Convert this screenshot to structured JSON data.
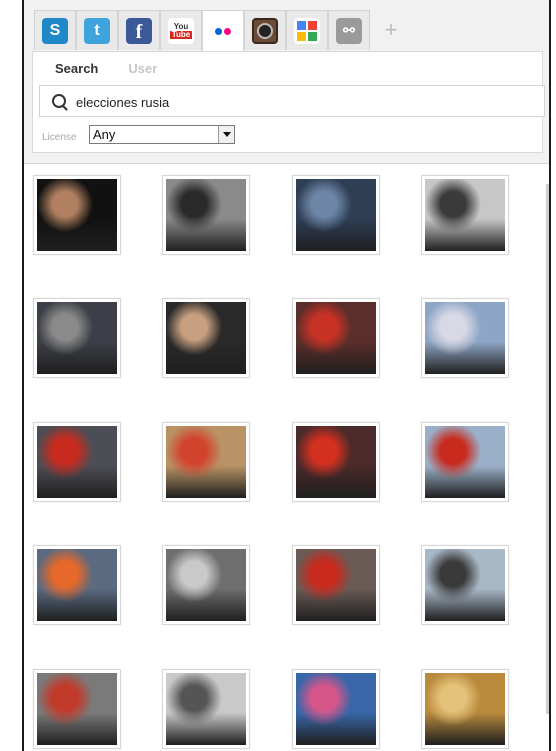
{
  "service_tabs": [
    {
      "id": "s",
      "label": "S",
      "color": "#1e88c8",
      "icon": "s-logo-icon"
    },
    {
      "id": "twitter",
      "label": "t",
      "color": "#3fa3dd",
      "icon": "twitter-bird-icon"
    },
    {
      "id": "facebook",
      "label": "f",
      "color": "#3b5998",
      "icon": "facebook-icon"
    },
    {
      "id": "youtube",
      "label": "You Tube",
      "color": "#d8281f",
      "icon": "youtube-icon"
    },
    {
      "id": "flickr",
      "label": "",
      "color": "#ffffff",
      "icon": "flickr-icon",
      "active": true
    },
    {
      "id": "instagram",
      "label": "",
      "color": "#6b4b36",
      "icon": "instagram-camera-icon"
    },
    {
      "id": "google",
      "label": "",
      "color": "#ffffff",
      "icon": "google-icon"
    },
    {
      "id": "link",
      "label": "",
      "color": "#9a9a9a",
      "icon": "link-icon"
    }
  ],
  "add_tab_label": "+",
  "search": {
    "tab_search": "Search",
    "tab_user": "User",
    "query": "elecciones rusia",
    "license_label": "License",
    "license_value": "Any"
  },
  "photos": [
    {
      "icon": "putin-fisheye-photo",
      "bg": "#111111",
      "accent": "#b08060"
    },
    {
      "icon": "protest-gate-photo",
      "bg": "#8a8a8a",
      "accent": "#2a2a2a"
    },
    {
      "icon": "police-crowd-photo",
      "bg": "#2e3e55",
      "accent": "#6d86a6"
    },
    {
      "icon": "street-protest-photo",
      "bg": "#c7c7c7",
      "accent": "#3a3a3a"
    },
    {
      "icon": "riot-police-photo",
      "bg": "#3c3f47",
      "accent": "#8a8a8a"
    },
    {
      "icon": "speaker-man-photo",
      "bg": "#2a2a2a",
      "accent": "#c8a080"
    },
    {
      "icon": "red-flags-crowd-photo",
      "bg": "#5a2e2a",
      "accent": "#c83225"
    },
    {
      "icon": "goodbye-putin-sign-photo",
      "bg": "#8ea6c6",
      "accent": "#d9d9e5"
    },
    {
      "icon": "red-flags-rally-photo",
      "bg": "#4d4d55",
      "accent": "#c82a1e"
    },
    {
      "icon": "banner-rally-photo",
      "bg": "#b99265",
      "accent": "#d2432e"
    },
    {
      "icon": "red-flags-square-photo",
      "bg": "#4a2a2a",
      "accent": "#d33020"
    },
    {
      "icon": "flags-city-rally-photo",
      "bg": "#9ab0c8",
      "accent": "#c82a1e"
    },
    {
      "icon": "orange-flags-photo",
      "bg": "#5a6a80",
      "accent": "#e6682a"
    },
    {
      "icon": "placard-crowd-photo",
      "bg": "#6e6e6e",
      "accent": "#c9c9c9"
    },
    {
      "icon": "russian-flag-rally-photo",
      "bg": "#6a5a55",
      "accent": "#c82a1e"
    },
    {
      "icon": "red-square-kremlin-photo",
      "bg": "#a9b8c7",
      "accent": "#3a3a3a"
    },
    {
      "icon": "kremlin-star-photo",
      "bg": "#7a7a7a",
      "accent": "#c23a2a"
    },
    {
      "icon": "election-poster-photo",
      "bg": "#c9c9c9",
      "accent": "#555555"
    },
    {
      "icon": "putin-poster-photo",
      "bg": "#3866a8",
      "accent": "#d6568a"
    },
    {
      "icon": "golden-hall-photo",
      "bg": "#b98a3c",
      "accent": "#e5c27a"
    }
  ]
}
